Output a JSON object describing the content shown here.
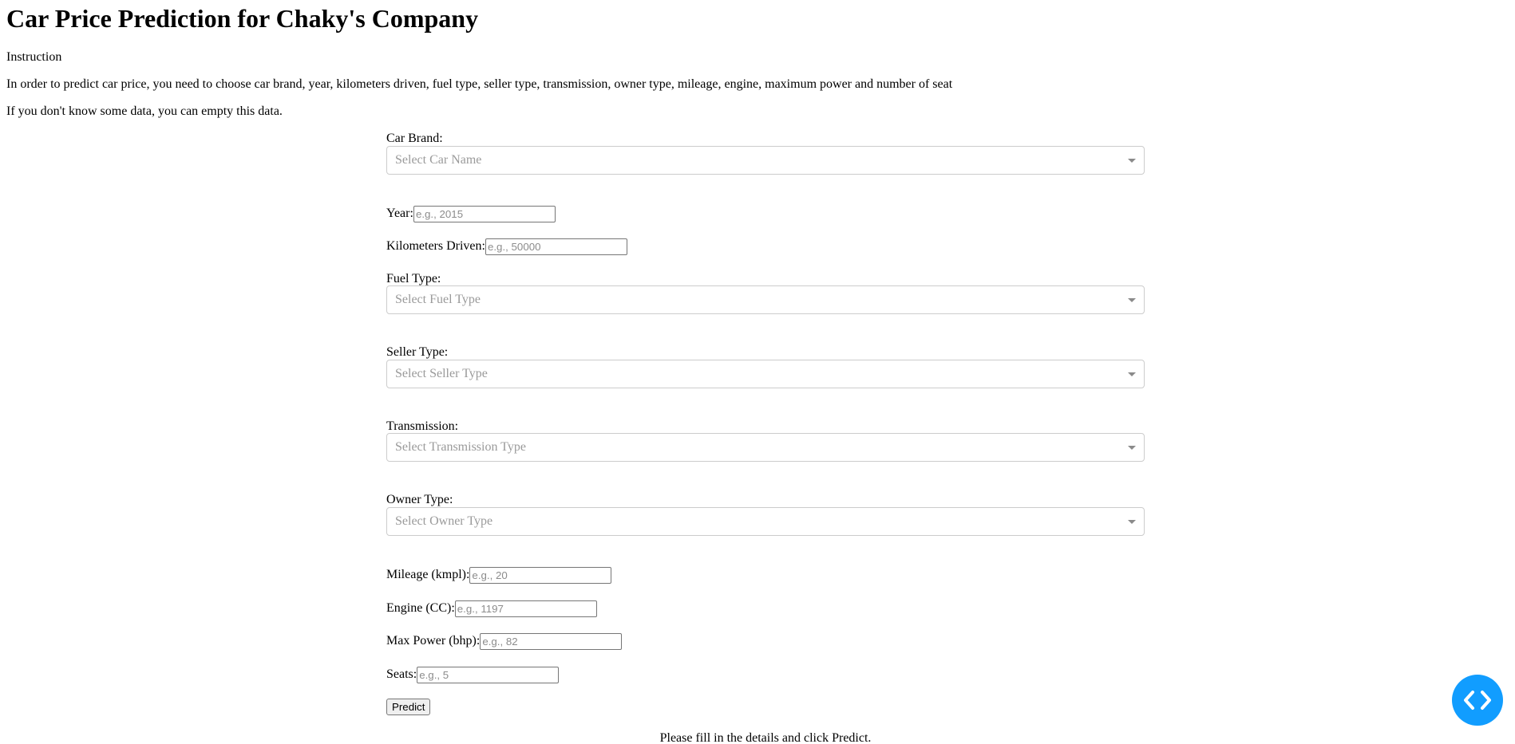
{
  "header": {
    "title": "Car Price Prediction for Chaky's Company"
  },
  "instructions": {
    "heading": "Instruction",
    "line1": "In order to predict car price, you need to choose car brand, year, kilometers driven, fuel type, seller type, transmission, owner type, mileage, engine, maximum power and number of seat",
    "line2": "If you don't know some data, you can empty this data."
  },
  "form": {
    "brand": {
      "label": "Car Brand:",
      "placeholder": "Select Car Name"
    },
    "year": {
      "label": "Year:",
      "placeholder": "e.g., 2015",
      "value": ""
    },
    "km_driven": {
      "label": "Kilometers Driven:",
      "placeholder": "e.g., 50000",
      "value": ""
    },
    "fuel": {
      "label": "Fuel Type:",
      "placeholder": "Select Fuel Type"
    },
    "seller": {
      "label": "Seller Type:",
      "placeholder": "Select Seller Type"
    },
    "transmission": {
      "label": "Transmission:",
      "placeholder": "Select Transmission Type"
    },
    "owner": {
      "label": "Owner Type:",
      "placeholder": "Select Owner Type"
    },
    "mileage": {
      "label": "Mileage (kmpl):",
      "placeholder": "e.g., 20",
      "value": ""
    },
    "engine": {
      "label": "Engine (CC):",
      "placeholder": "e.g., 1197",
      "value": ""
    },
    "max_power": {
      "label": "Max Power (bhp):",
      "placeholder": "e.g., 82",
      "value": ""
    },
    "seats": {
      "label": "Seats:",
      "placeholder": "e.g., 5",
      "value": ""
    },
    "predict_label": "Predict"
  },
  "result": {
    "message": "Please fill in the details and click Predict."
  },
  "debug_fab": {
    "icon": "code-brackets-icon",
    "color": "#119dff"
  }
}
